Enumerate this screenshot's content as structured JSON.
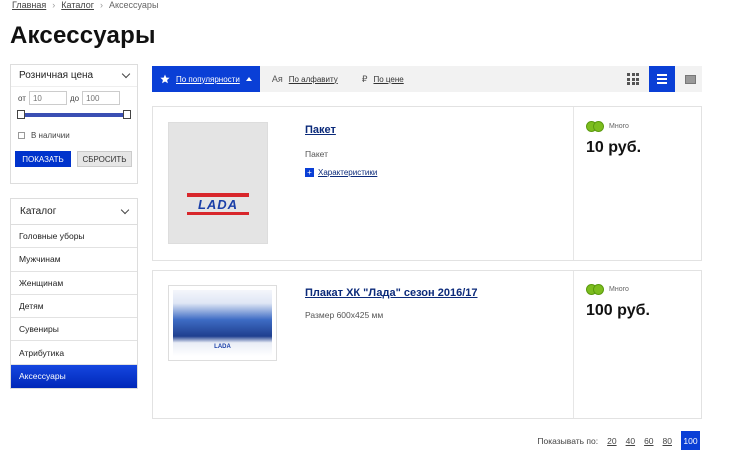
{
  "breadcrumb": {
    "home": "Главная",
    "catalog": "Каталог",
    "current": "Аксессуары"
  },
  "page_title": "Аксессуары",
  "filter": {
    "title": "Розничная цена",
    "from_label": "от",
    "from_placeholder": "10",
    "to_label": "до",
    "to_placeholder": "100",
    "in_stock_label": "В наличии",
    "show_button": "ПОКАЗАТЬ",
    "reset_button": "СБРОСИТЬ"
  },
  "catalog": {
    "title": "Каталог",
    "items": [
      {
        "label": "Головные уборы"
      },
      {
        "label": "Мужчинам"
      },
      {
        "label": "Женщинам"
      },
      {
        "label": "Детям"
      },
      {
        "label": "Сувениры"
      },
      {
        "label": "Атрибутика"
      },
      {
        "label": "Аксессуары"
      }
    ],
    "active_index": 6
  },
  "sort": {
    "popular": "По популярности",
    "alpha_icon": "Aя",
    "alpha": "По алфавиту",
    "price_icon": "₽",
    "price": "По цене"
  },
  "products": [
    {
      "name": "Пакет",
      "description": "Пакет",
      "characteristics": "Характеристики",
      "stock": "Много",
      "price": "10 руб.",
      "image_text": "LADA"
    },
    {
      "name": "Плакат ХК \"Лада\" сезон 2016/17",
      "description": "Размер 600х425 мм",
      "stock": "Много",
      "price": "100 руб.",
      "image_text": "LADA"
    }
  ],
  "pager": {
    "label": "Показывать по:",
    "options": [
      "20",
      "40",
      "60",
      "80",
      "100"
    ],
    "active": "100"
  },
  "colors": {
    "accent": "#0a3fd6",
    "stock_green": "#7cbd1e",
    "link": "#0b2a7a"
  }
}
